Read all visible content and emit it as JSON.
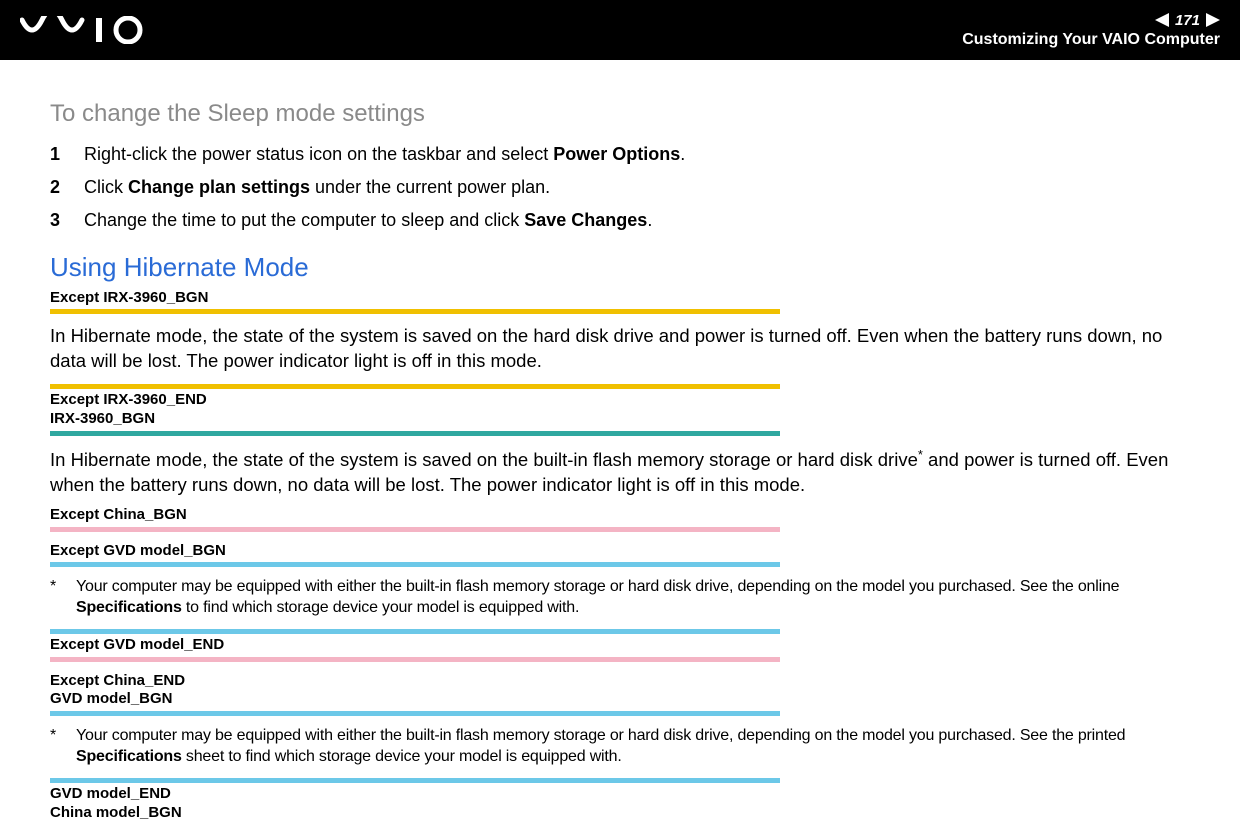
{
  "header": {
    "page_number": "171",
    "subtitle": "Customizing Your VAIO Computer"
  },
  "section1": {
    "title": "To change the Sleep mode settings",
    "steps": {
      "n1": "1",
      "t1a": "Right-click the power status icon on the taskbar and select ",
      "t1b": "Power Options",
      "t1c": ".",
      "n2": "2",
      "t2a": "Click ",
      "t2b": "Change plan settings",
      "t2c": " under the current power plan.",
      "n3": "3",
      "t3a": "Change the time to put the computer to sleep and click ",
      "t3b": "Save Changes",
      "t3c": "."
    }
  },
  "section2": {
    "title": "Using Hibernate Mode",
    "tag_irx_bgn": "Except IRX-3960_BGN",
    "para1": "In Hibernate mode, the state of the system is saved on the hard disk drive and power is turned off. Even when the battery runs down, no data will be lost. The power indicator light is off in this mode.",
    "tag_irx_end_line1": "Except IRX-3960_END",
    "tag_irx_end_line2": "IRX-3960_BGN",
    "para2a": "In Hibernate mode, the state of the system is saved on the built-in flash memory storage or hard disk drive",
    "para2sup": "*",
    "para2b": " and power is turned off. Even when the battery runs down, no data will be lost. The power indicator light is off in this mode.",
    "tag_china_bgn": "Except China_BGN",
    "tag_gvd_bgn": "Except GVD model_BGN",
    "fn1_ast": "*",
    "fn1a": "Your computer may be equipped with either the built-in flash memory storage or hard disk drive, depending on the model you purchased. See the online ",
    "fn1b": "Specifications",
    "fn1c": " to find which storage device your model is equipped with.",
    "tag_gvd_end": "Except GVD model_END",
    "tag_china_end_line1": "Except China_END",
    "tag_china_end_line2": "GVD model_BGN",
    "fn2_ast": "*",
    "fn2a": "Your computer may be equipped with either the built-in flash memory storage or hard disk drive, depending on the model you purchased. See the printed ",
    "fn2b": "Specifications",
    "fn2c": " sheet to find which storage device your model is equipped with.",
    "tag_gvd_model_end_line1": "GVD model_END",
    "tag_gvd_model_end_line2": "China model_BGN"
  }
}
